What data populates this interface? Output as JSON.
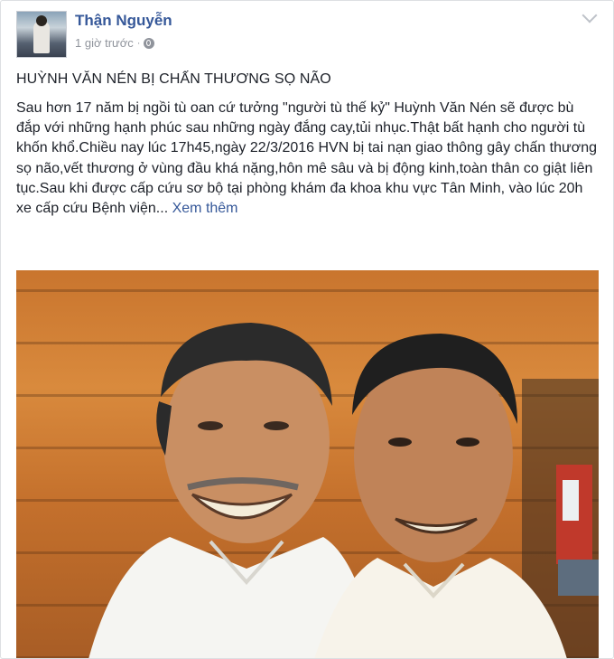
{
  "post": {
    "author": "Thận Nguyễn",
    "time": "1 giờ trước",
    "separator": "·",
    "privacy_icon": "globe-icon",
    "headline": "HUỲNH VĂN NÉN BỊ CHẤN THƯƠNG SỌ NÃO",
    "body": "Sau hơn 17 năm bị ngồi tù oan cứ tưởng \"người tù thế kỷ\" Huỳnh Văn Nén sẽ được bù đắp với những hạnh phúc sau những ngày đắng cay,tủi nhục.Thật bất hạnh cho người tù khốn khổ.Chiều nay lúc 17h45,ngày 22/3/2016 HVN bị tai nạn giao thông gây chấn thương sọ não,vết thương ở vùng đầu khá nặng,hôn mê sâu và bị động kinh,toàn thân co giật liên tục.Sau khi được cấp cứu sơ bộ tại phòng khám đa khoa khu vực Tân Minh, vào lúc 20h xe cấp cứu Bệnh viện...",
    "see_more": "Xem thêm"
  },
  "colors": {
    "link": "#365899",
    "meta": "#90949c",
    "text": "#1d2129"
  }
}
